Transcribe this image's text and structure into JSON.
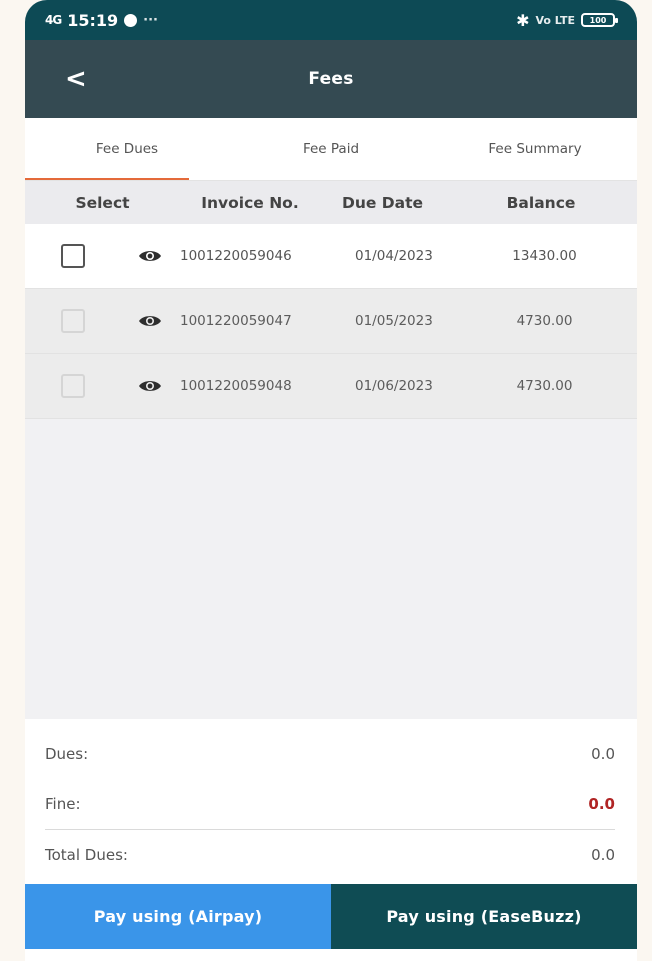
{
  "status_bar": {
    "signal": "4G",
    "time": "15:19",
    "dots": "···",
    "network": "Vo LTE",
    "battery": "100"
  },
  "app_bar": {
    "back": "<",
    "title": "Fees"
  },
  "tabs": [
    {
      "label": "Fee Dues",
      "active": true
    },
    {
      "label": "Fee Paid",
      "active": false
    },
    {
      "label": "Fee Summary",
      "active": false
    }
  ],
  "table": {
    "headers": {
      "select": "Select",
      "invoice": "Invoice No.",
      "due_date": "Due Date",
      "balance": "Balance"
    },
    "rows": [
      {
        "invoice": "1001220059046",
        "due_date": "01/04/2023",
        "balance": "13430.00",
        "enabled": true
      },
      {
        "invoice": "1001220059047",
        "due_date": "01/05/2023",
        "balance": "4730.00",
        "enabled": false
      },
      {
        "invoice": "1001220059048",
        "due_date": "01/06/2023",
        "balance": "4730.00",
        "enabled": false
      }
    ]
  },
  "summary": {
    "dues_label": "Dues:",
    "dues_value": "0.0",
    "fine_label": "Fine:",
    "fine_value": "0.0",
    "total_label": "Total Dues:",
    "total_value": "0.0"
  },
  "buttons": {
    "airpay": "Pay using (Airpay)",
    "easebuzz": "Pay using (EaseBuzz)"
  },
  "colors": {
    "status_bar": "#0d4a55",
    "app_bar": "#344a52",
    "tab_indicator": "#e46a3a",
    "airpay_button": "#3a95e9",
    "easebuzz_button": "#0f4c54",
    "fine_value": "#b02424"
  },
  "icons": {
    "back": "chevron-left-icon",
    "view": "eye-icon",
    "checkbox": "checkbox-icon"
  }
}
